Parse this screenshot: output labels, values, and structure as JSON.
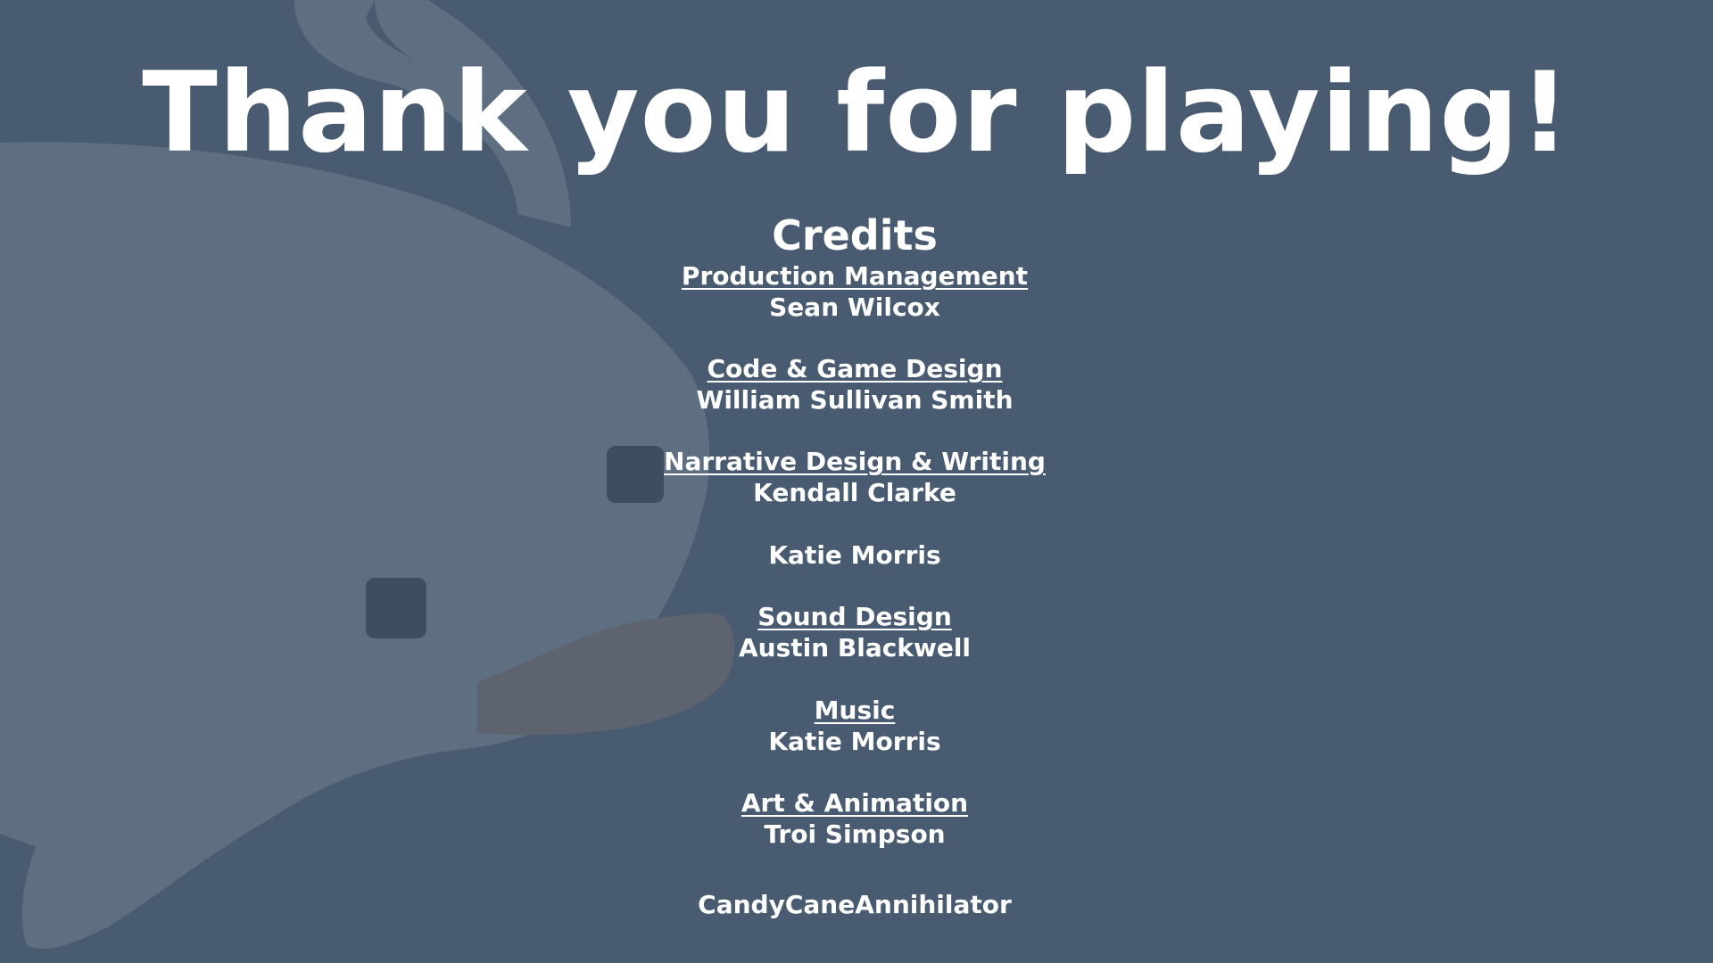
{
  "screen": {
    "title": "Thank you for playing!",
    "credits_heading": "Credits"
  },
  "credits": [
    {
      "role": "Production Management",
      "names": [
        "Sean Wilcox"
      ]
    },
    {
      "role": "Code & Game Design",
      "names": [
        "William Sullivan Smith"
      ]
    },
    {
      "role": "Narrative Design & Writing",
      "names": [
        "Kendall Clarke",
        "Katie Morris"
      ]
    },
    {
      "role": "Sound Design",
      "names": [
        "Austin Blackwell"
      ]
    },
    {
      "role": "Music",
      "names": [
        "Katie Morris"
      ]
    },
    {
      "role": "Art & Animation",
      "names": [
        "Troi Simpson",
        "CandyCaneAnnihilator"
      ]
    }
  ],
  "colors": {
    "background": "#485b70",
    "character": "#5e6f82",
    "character_eye": "#3e4d60",
    "character_mouth": "#5d6470",
    "text": "#ffffff"
  },
  "icons": {
    "background_character": "ghost-seal-silhouette"
  }
}
